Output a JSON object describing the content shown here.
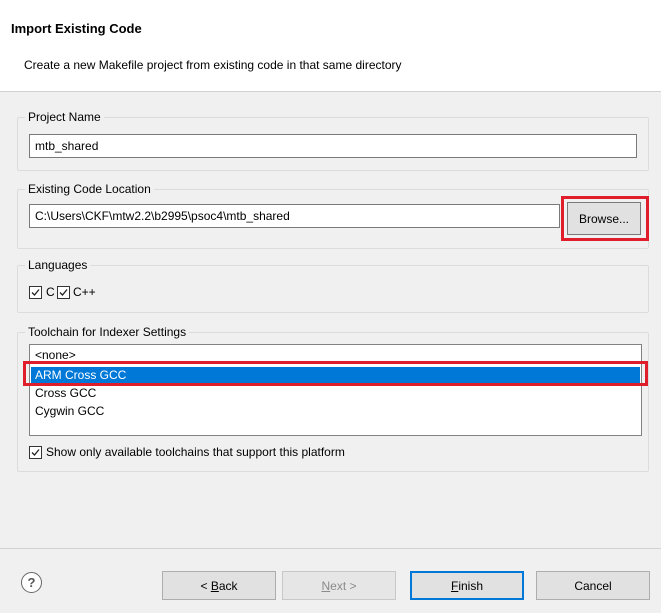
{
  "dialog": {
    "title": "Import Existing Code",
    "description": "Create a new Makefile project from existing code in that same directory"
  },
  "project_name": {
    "label": "Project Name",
    "value": "mtb_shared"
  },
  "code_location": {
    "label": "Existing Code Location",
    "value": "C:\\Users\\CKF\\mtw2.2\\b2995\\psoc4\\mtb_shared",
    "browse_label": "Browse..."
  },
  "languages": {
    "label": "Languages",
    "items": [
      {
        "label": "C",
        "checked": true
      },
      {
        "label": "C++",
        "checked": true
      }
    ]
  },
  "toolchain": {
    "label": "Toolchain for Indexer Settings",
    "items": [
      "<none>",
      "ARM Cross GCC",
      "Cross GCC",
      "Cygwin GCC"
    ],
    "selected": "ARM Cross GCC",
    "show_only_label": "Show only available toolchains that support this platform",
    "show_only_checked": true
  },
  "footer": {
    "help_icon": "help-icon",
    "back_prefix": "< ",
    "back_mnemonic": "B",
    "back_rest": "ack",
    "next_mnemonic": "N",
    "next_rest": "ext >",
    "finish_mnemonic": "F",
    "finish_rest": "inish",
    "cancel_label": "Cancel"
  },
  "colors": {
    "highlight": "#e01d2a",
    "selection": "#0078d7"
  }
}
